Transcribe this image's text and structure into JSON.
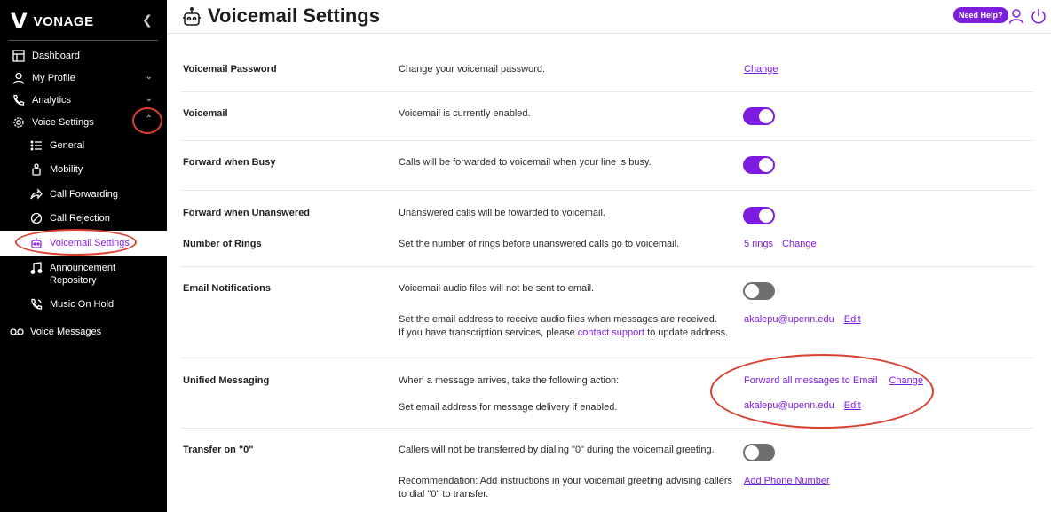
{
  "sidebar": {
    "logo_text": "VONAGE",
    "items": [
      {
        "label": "Dashboard",
        "icon": "dashboard-icon"
      },
      {
        "label": "My Profile",
        "icon": "user-icon"
      },
      {
        "label": "Analytics",
        "icon": "phone-icon"
      },
      {
        "label": "Voice Settings",
        "icon": "gear-icon"
      }
    ],
    "voice_settings_sub": [
      {
        "label": "General"
      },
      {
        "label": "Mobility"
      },
      {
        "label": "Call Forwarding"
      },
      {
        "label": "Call Rejection"
      },
      {
        "label": "Voicemail Settings"
      },
      {
        "label": "Announcement Repository"
      },
      {
        "label": "Music On Hold"
      }
    ],
    "voice_messages": "Voice Messages"
  },
  "header": {
    "title": "Voicemail Settings",
    "help_label": "Need Help?"
  },
  "settings": {
    "password": {
      "label": "Voicemail Password",
      "desc": "Change your voicemail password.",
      "action": "Change"
    },
    "voicemail": {
      "label": "Voicemail",
      "desc": "Voicemail is currently enabled.",
      "enabled": true
    },
    "busy": {
      "label": "Forward when Busy",
      "desc": "Calls will be forwarded to voicemail when your line is busy.",
      "enabled": true
    },
    "unanswered": {
      "label": "Forward when Unanswered",
      "desc": "Unanswered calls will be fowarded to voicemail.",
      "enabled": true
    },
    "rings": {
      "label": "Number of Rings",
      "desc": "Set the number of rings before unanswered calls go to voicemail.",
      "value": "5 rings",
      "action": "Change"
    },
    "email_notif": {
      "label": "Email Notifications",
      "desc": "Voicemail audio files will not be sent to email.",
      "enabled": false,
      "addr_desc_1": "Set the email address to receive audio files when messages are received.",
      "addr_desc_2a": "If you have transcription services, please",
      "addr_desc_link": "contact support",
      "addr_desc_2b": "to update address.",
      "email": "akalepu@upenn.edu",
      "action": "Edit"
    },
    "unified": {
      "label": "Unified Messaging",
      "desc": "When a message arrives, take the following action:",
      "value": "Forward all messages to Email",
      "action": "Change",
      "addr_desc": "Set email address for message delivery if enabled.",
      "email": "akalepu@upenn.edu",
      "email_action": "Edit"
    },
    "transfer": {
      "label": "Transfer on \"0\"",
      "desc": "Callers will not be transferred by dialing \"0\" during the voicemail greeting.",
      "enabled": false,
      "rec_1": "Recommendation: Add instructions in your voicemail greeting advising callers",
      "rec_2": "to dial \"0\" to transfer.",
      "action": "Add Phone Number"
    }
  },
  "colors": {
    "accent": "#7d1ce0",
    "annotation": "#d9412e",
    "sidebar_bg": "#000000"
  }
}
